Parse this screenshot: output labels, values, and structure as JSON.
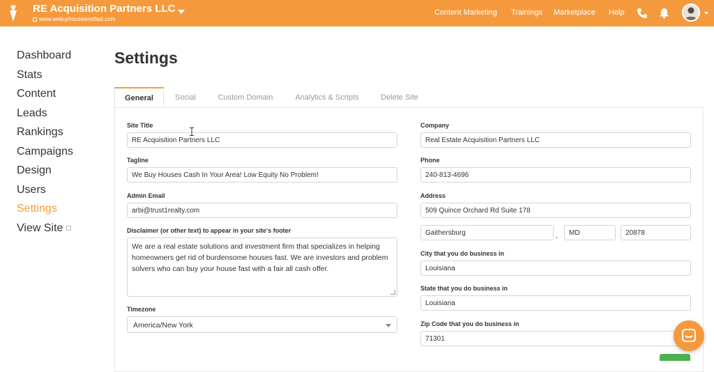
{
  "header": {
    "site_name": "RE Acquisition Partners LLC",
    "site_url": "www.webuyhousesmdfast.com",
    "nav": [
      "Content Marketing",
      "Trainings",
      "Marketplace",
      "Help"
    ],
    "accent_color": "#f59a3c"
  },
  "sidebar": {
    "items": [
      "Dashboard",
      "Stats",
      "Content",
      "Leads",
      "Rankings",
      "Campaigns",
      "Design",
      "Users",
      "Settings",
      "View Site"
    ],
    "active": "Settings"
  },
  "page": {
    "title": "Settings",
    "tabs": [
      "General",
      "Social",
      "Custom Domain",
      "Analytics & Scripts",
      "Delete Site"
    ],
    "active_tab": "General"
  },
  "form": {
    "site_title_label": "Site Title",
    "site_title_value": "RE Acquisition Partners LLC",
    "tagline_label": "Tagline",
    "tagline_value": "We Buy Houses Cash In Your Area! Low Equity No Problem!",
    "admin_email_label": "Admin Email",
    "admin_email_value": "arbi@trust1realty.com",
    "disclaimer_label": "Disclaimer (or other text) to appear in your site's footer",
    "disclaimer_value": "We are a real estate solutions and investment firm that specializes in helping homeowners get rid of burdensome houses fast. We are investors and problem solvers who can buy your house fast with a fair all cash offer.",
    "timezone_label": "Timezone",
    "timezone_value": "America/New York",
    "company_label": "Company",
    "company_value": "Real Estate Acquisition Partners LLC",
    "phone_label": "Phone",
    "phone_value": "240-813-4696",
    "address_label": "Address",
    "address_value": "509 Quince Orchard Rd Suite 178",
    "city_value": "Gaithersburg",
    "state_value": "MD",
    "zip_value": "20878",
    "biz_city_label": "City that you do business in",
    "biz_city_value": "Louisiana",
    "biz_state_label": "State that you do business in",
    "biz_state_value": "Louisiana",
    "biz_zip_label": "Zip Code that you do business in",
    "biz_zip_value": "71301"
  }
}
